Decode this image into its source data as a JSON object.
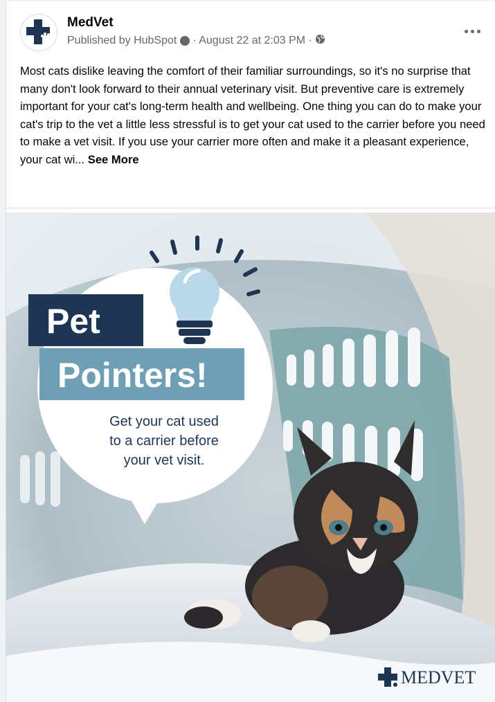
{
  "post": {
    "page_name": "MedVet",
    "published_by": "Published by HubSpot",
    "timestamp": "· August 22 at 2:03 PM ·",
    "more_label": "•••",
    "body": "Most cats dislike leaving the comfort of their familiar surroundings, so it's no surprise that many don't look forward to their annual veterinary visit. But preventive care is extremely important for your cat's long-term health and wellbeing. One thing you can do to make your cat's trip to the vet a little less stressful is to get your cat used to the carrier before you need to make a vet visit. If you use your carrier more often and make it a pleasant experience, your cat wi...",
    "see_more": "See More"
  },
  "image": {
    "banner_line1": "Pet",
    "banner_line2": "Pointers!",
    "tip_line1": "Get your cat used",
    "tip_line2": "to a carrier before",
    "tip_line3": "your vet visit.",
    "logo_text": "MEDVET"
  },
  "icons": {
    "avatar": "medvet-cross-paw-icon",
    "info": "info-circle-icon",
    "audience": "globe-icon",
    "more": "more-options-icon",
    "bulb": "lightbulb-icon"
  },
  "colors": {
    "brand_navy": "#1e3553",
    "brand_teal": "#6f9fb5",
    "meta_gray": "#65676b"
  }
}
